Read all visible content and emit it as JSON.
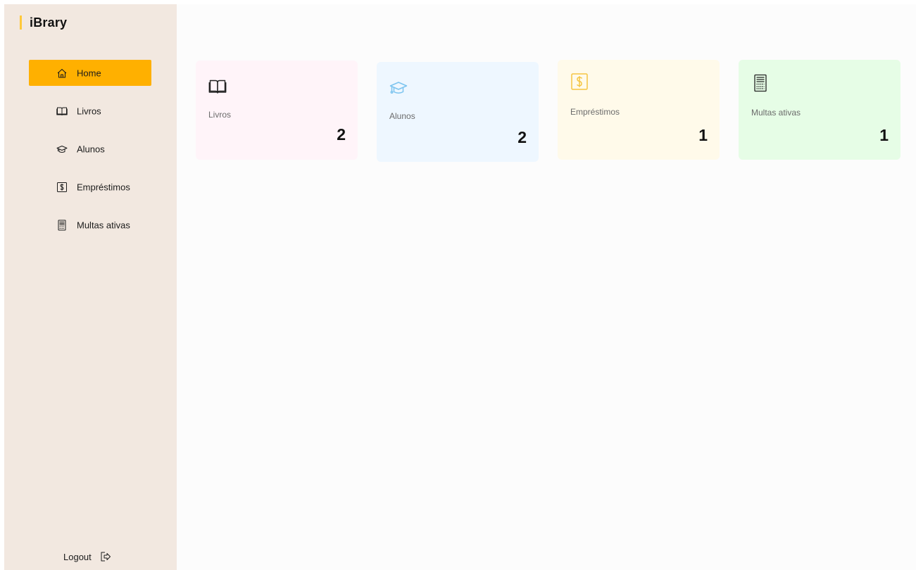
{
  "app": {
    "brand": "iBrary",
    "accent_color": "#ffb000",
    "brand_bar_color": "#ffc93a",
    "sidebar_bg": "#f2e8e0"
  },
  "sidebar": {
    "items": [
      {
        "label": "Home",
        "icon": "home-icon",
        "active": true
      },
      {
        "label": "Livros",
        "icon": "book-icon",
        "active": false
      },
      {
        "label": "Alunos",
        "icon": "graduation-cap-icon",
        "active": false
      },
      {
        "label": "Empréstimos",
        "icon": "dollar-sign-icon",
        "active": false
      },
      {
        "label": "Multas ativas",
        "icon": "receipt-icon",
        "active": false
      }
    ],
    "logout_label": "Logout",
    "logout_icon": "logout-icon"
  },
  "cards": [
    {
      "label": "Livros",
      "value": "2",
      "icon": "book-icon",
      "bg": "#fff4f9",
      "icon_color": "#222222"
    },
    {
      "label": "Alunos",
      "value": "2",
      "icon": "graduation-cap-icon",
      "bg": "#eef7ff",
      "icon_color": "#7cc4ef"
    },
    {
      "label": "Empréstimos",
      "value": "1",
      "icon": "dollar-sign-icon",
      "bg": "#fffaea",
      "icon_color": "#f5c542"
    },
    {
      "label": "Multas ativas",
      "value": "1",
      "icon": "receipt-icon",
      "bg": "#e6fde6",
      "icon_color": "#222222"
    }
  ]
}
